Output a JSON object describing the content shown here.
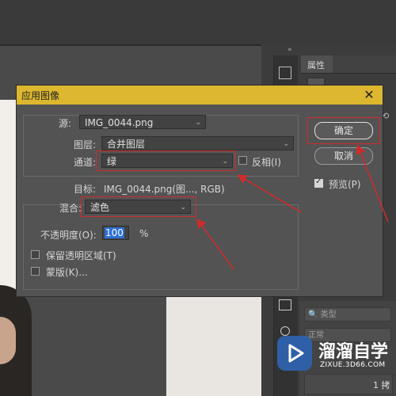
{
  "dialog": {
    "title": "应用图像",
    "source_label": "源:",
    "source_value": "IMG_0044.png",
    "layer_label": "图层:",
    "layer_value": "合并图层",
    "channel_label": "通道:",
    "channel_value": "绿",
    "invert_label": "反相(I)",
    "target_label": "目标:",
    "target_value": "IMG_0044.png(图..., RGB)",
    "blending_label": "混合:",
    "blending_value": "滤色",
    "opacity_label": "不透明度(O):",
    "opacity_value": "100",
    "opacity_unit": "%",
    "preserve_transparency_label": "保留透明区域(T)",
    "mask_label": "蒙版(K)...",
    "ok_label": "确定",
    "cancel_label": "取消",
    "preview_label": "预览(P)",
    "preview_checked": true,
    "invert_checked": false,
    "preserve_transparency_checked": false,
    "mask_checked": false
  },
  "panels": {
    "properties_tab": "属性",
    "collapse_glyph": "«",
    "layers_search_placeholder": "类型",
    "blend_mode_value": "正常",
    "layer_label_partial": "1 拷"
  },
  "watermark": {
    "name": "溜溜自学",
    "url": "ZIXUE.3D66.COM"
  },
  "colors": {
    "title_bar": "#dcb72f",
    "annotation_red": "#d12b2b",
    "dialog_bg": "#535353",
    "ps_dark": "#3a3a3a"
  }
}
